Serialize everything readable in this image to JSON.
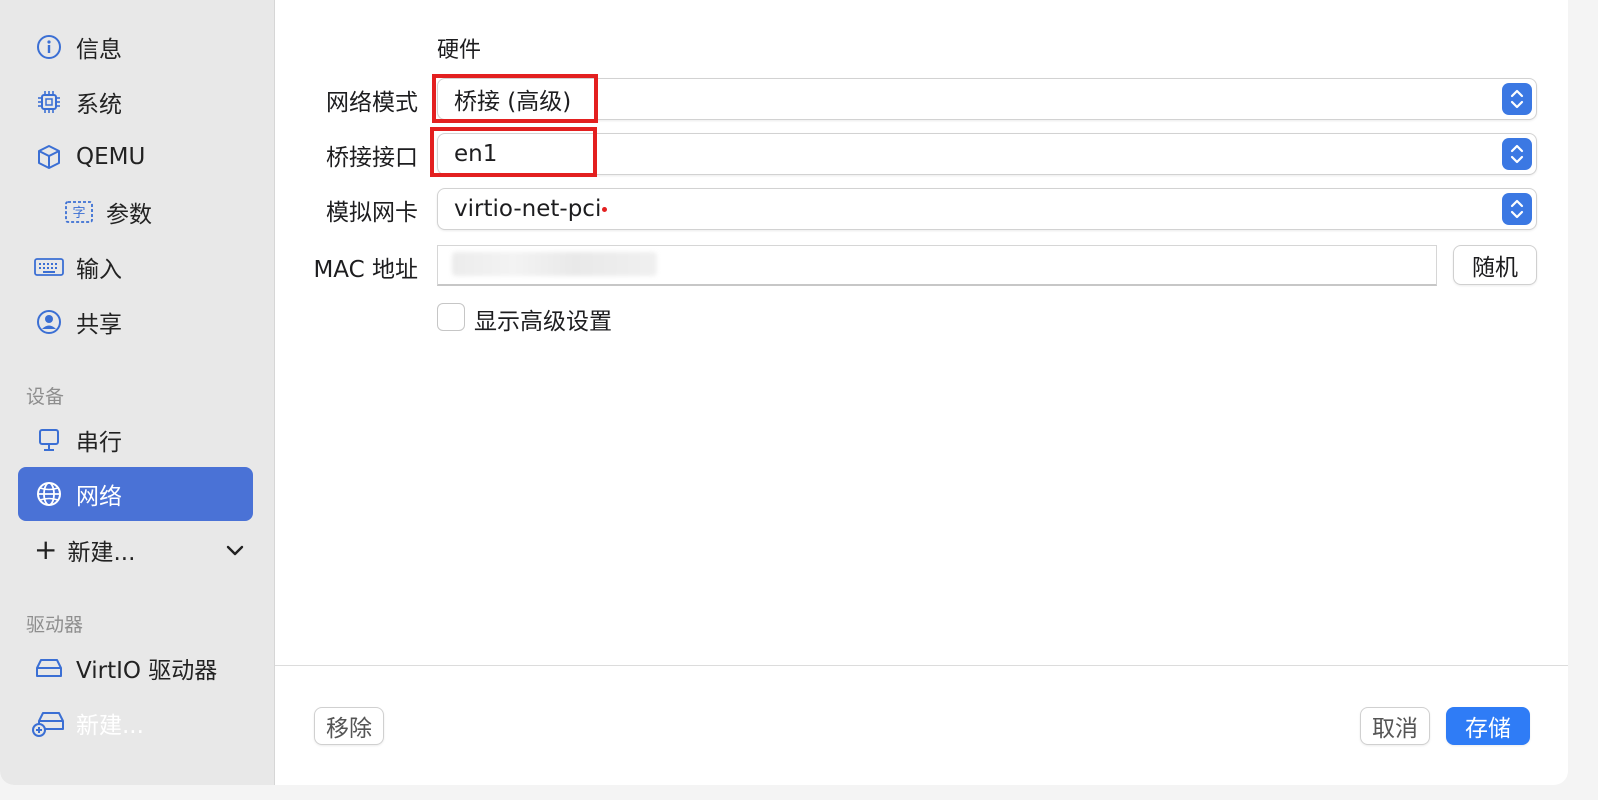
{
  "sidebar": {
    "items": [
      {
        "label": "信息",
        "icon": "info-icon"
      },
      {
        "label": "系统",
        "icon": "cpu-icon"
      },
      {
        "label": "QEMU",
        "icon": "cube-icon"
      },
      {
        "label": "参数",
        "icon": "text-char-icon"
      },
      {
        "label": "输入",
        "icon": "keyboard-icon"
      },
      {
        "label": "共享",
        "icon": "person-icon"
      }
    ],
    "section_devices": "设备",
    "devices": [
      {
        "label": "串行",
        "icon": "monitor-icon"
      },
      {
        "label": "网络",
        "icon": "globe-icon",
        "selected": true
      }
    ],
    "new_device_label": "新建...",
    "section_drives": "驱动器",
    "drives": [
      {
        "label": "VirtIO 驱动器",
        "icon": "drive-icon"
      },
      {
        "label": "新建...",
        "icon": "drive-add-icon"
      }
    ]
  },
  "main": {
    "section_title": "硬件",
    "network_mode": {
      "label": "网络模式",
      "value": "桥接 (高级)"
    },
    "bridge_interface": {
      "label": "桥接接口",
      "value": "en1"
    },
    "emulated_nic": {
      "label": "模拟网卡",
      "value": "virtio-net-pci"
    },
    "mac_address": {
      "label": "MAC 地址",
      "value": ""
    },
    "random_button": "随机",
    "show_advanced": {
      "label": "显示高级设置",
      "checked": false
    }
  },
  "footer": {
    "remove_label": "移除",
    "cancel_label": "取消",
    "save_label": "存储"
  },
  "colors": {
    "accent": "#4a72d6",
    "primary_button": "#2f7cf6",
    "highlight_box": "#e32020"
  }
}
